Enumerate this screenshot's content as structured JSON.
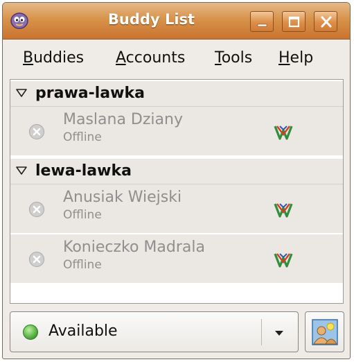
{
  "window": {
    "title": "Buddy List",
    "controls": {
      "minimize": "minimize",
      "maximize": "maximize",
      "close": "close"
    }
  },
  "menu": {
    "items": [
      {
        "mnemonic": "B",
        "rest": "uddies"
      },
      {
        "mnemonic": "A",
        "rest": "ccounts"
      },
      {
        "mnemonic": "T",
        "rest": "ools"
      },
      {
        "mnemonic": "H",
        "rest": "elp"
      }
    ]
  },
  "groups": [
    {
      "name": "prawa-lawka",
      "expanded": true,
      "buddies": [
        {
          "name": "Maslana Dziany",
          "status": "Offline",
          "protocol_icon": "gadu-gadu-icon"
        }
      ]
    },
    {
      "name": "lewa-lawka",
      "expanded": true,
      "buddies": [
        {
          "name": "Anusiak Wiejski",
          "status": "Offline",
          "protocol_icon": "gadu-gadu-icon"
        },
        {
          "name": "Konieczko Madrala",
          "status": "Offline",
          "protocol_icon": "gadu-gadu-icon"
        }
      ]
    }
  ],
  "status_selector": {
    "value": "Available",
    "icon": "available-status-icon"
  },
  "colors": {
    "titlebar": "#d8934a",
    "offline_text": "#8f8f8f",
    "available": "#4fbf3a"
  }
}
